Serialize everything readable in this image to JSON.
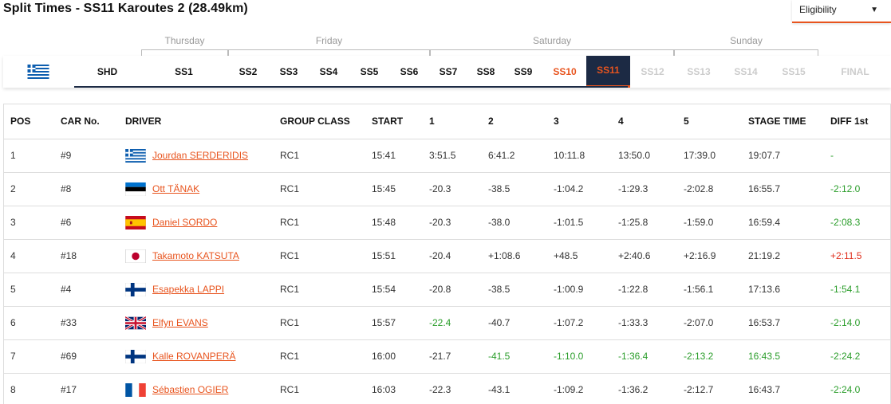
{
  "header": {
    "title": "Split Times - SS11 Karoutes 2 (28.49km)"
  },
  "eligibility": {
    "label": "Eligibility"
  },
  "days": [
    "Thursday",
    "Friday",
    "Saturday",
    "Sunday"
  ],
  "stages": [
    "SHD",
    "SS1",
    "SS2",
    "SS3",
    "SS4",
    "SS5",
    "SS6",
    "SS7",
    "SS8",
    "SS9",
    "SS10",
    "SS11",
    "SS12",
    "SS13",
    "SS14",
    "SS15",
    "FINAL"
  ],
  "columns": [
    "POS",
    "CAR No.",
    "DRIVER",
    "GROUP CLASS",
    "START",
    "1",
    "2",
    "3",
    "4",
    "5",
    "STAGE TIME",
    "DIFF 1st"
  ],
  "rows": [
    {
      "pos": "1",
      "car": "#9",
      "driver": "Jourdan SERDERIDIS",
      "flag": "greece",
      "group": "RC1",
      "start": "15:41",
      "s1": "3:51.5",
      "s2": "6:41.2",
      "s3": "10:11.8",
      "s4": "13:50.0",
      "s5": "17:39.0",
      "stage": "19:07.7",
      "diff": "-"
    },
    {
      "pos": "2",
      "car": "#8",
      "driver": "Ott TÄNAK",
      "flag": "estonia",
      "group": "RC1",
      "start": "15:45",
      "s1": "-20.3",
      "s2": "-38.5",
      "s3": "-1:04.2",
      "s4": "-1:29.3",
      "s5": "-2:02.8",
      "stage": "16:55.7",
      "diff": "-2:12.0"
    },
    {
      "pos": "3",
      "car": "#6",
      "driver": "Daniel SORDO",
      "flag": "spain",
      "group": "RC1",
      "start": "15:48",
      "s1": "-20.3",
      "s2": "-38.0",
      "s3": "-1:01.5",
      "s4": "-1:25.8",
      "s5": "-1:59.0",
      "stage": "16:59.4",
      "diff": "-2:08.3"
    },
    {
      "pos": "4",
      "car": "#18",
      "driver": "Takamoto KATSUTA",
      "flag": "japan",
      "group": "RC1",
      "start": "15:51",
      "s1": "-20.4",
      "s2": "+1:08.6",
      "s3": "+48.5",
      "s4": "+2:40.6",
      "s5": "+2:16.9",
      "stage": "21:19.2",
      "diff": "+2:11.5"
    },
    {
      "pos": "5",
      "car": "#4",
      "driver": "Esapekka LAPPI",
      "flag": "finland",
      "group": "RC1",
      "start": "15:54",
      "s1": "-20.8",
      "s2": "-38.5",
      "s3": "-1:00.9",
      "s4": "-1:22.8",
      "s5": "-1:56.1",
      "stage": "17:13.6",
      "diff": "-1:54.1"
    },
    {
      "pos": "6",
      "car": "#33",
      "driver": "Elfyn EVANS",
      "flag": "uk",
      "group": "RC1",
      "start": "15:57",
      "s1": "-22.4",
      "s2": "-40.7",
      "s3": "-1:07.2",
      "s4": "-1:33.3",
      "s5": "-2:07.0",
      "stage": "16:53.7",
      "diff": "-2:14.0"
    },
    {
      "pos": "7",
      "car": "#69",
      "driver": "Kalle ROVANPERÄ",
      "flag": "finland",
      "group": "RC1",
      "start": "16:00",
      "s1": "-21.7",
      "s2": "-41.5",
      "s3": "-1:10.0",
      "s4": "-1:36.4",
      "s5": "-2:13.2",
      "stage": "16:43.5",
      "diff": "-2:24.2"
    },
    {
      "pos": "8",
      "car": "#17",
      "driver": "Sébastien OGIER",
      "flag": "france",
      "group": "RC1",
      "start": "16:03",
      "s1": "-22.3",
      "s2": "-43.1",
      "s3": "-1:09.2",
      "s4": "-1:36.2",
      "s5": "-2:12.7",
      "stage": "16:43.7",
      "diff": "-2:24.0"
    }
  ],
  "highlights": {
    "green": [
      "5-s1",
      "6-s2",
      "6-s3",
      "6-s4",
      "6-s5",
      "6-stage",
      "0-diff",
      "1-diff",
      "2-diff",
      "4-diff",
      "5-diff",
      "6-diff",
      "7-diff"
    ],
    "red": [
      "3-diff"
    ]
  },
  "colors": {
    "accent": "#e8541e",
    "navy": "#1c2a44",
    "best": "#2a9d2a",
    "worse": "#e0301e"
  }
}
